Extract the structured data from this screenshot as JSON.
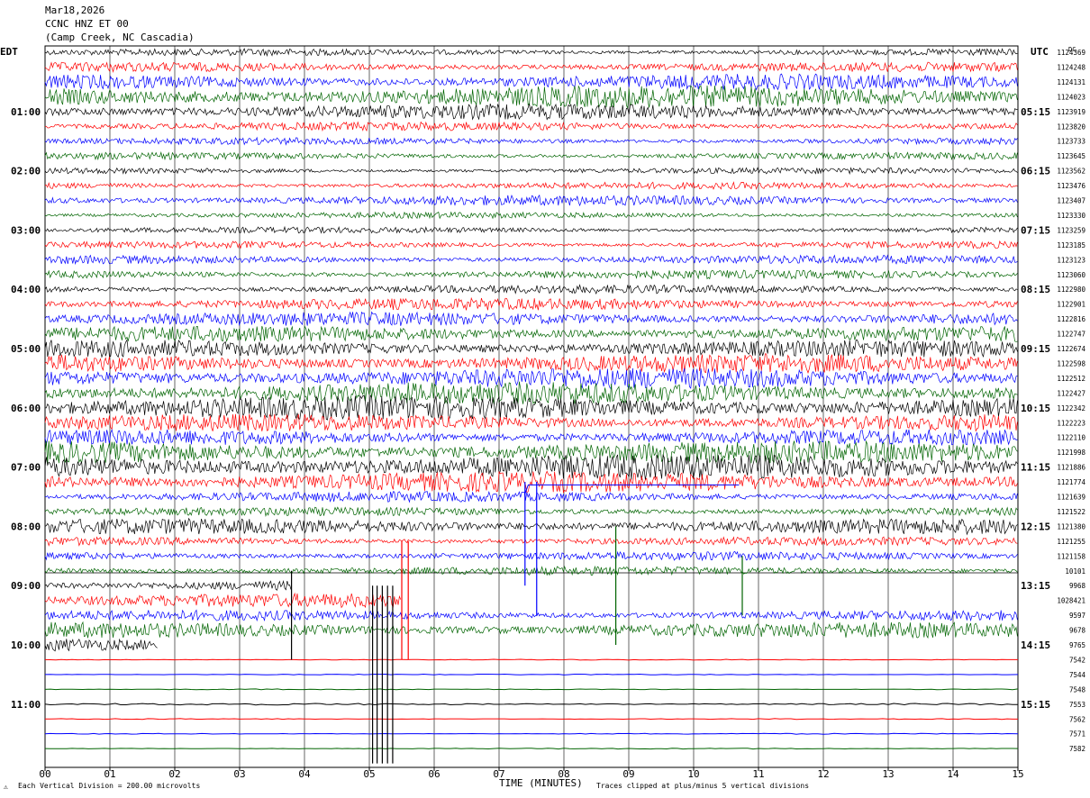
{
  "header": {
    "date": "Mar18,2026",
    "station": "CCNC HNZ ET 00",
    "location": "(Camp Creek, NC Cascadia)"
  },
  "left_axis_title": "EDT",
  "right_axis_title": "UTC",
  "right_corner_code": "DC",
  "footer": {
    "scale_note": "Each Vertical Division =  200.00 microvolts",
    "xlabel": "TIME (MINUTES)",
    "clip_note": "Traces clipped at plus/minus 5 vertical divisions",
    "corner_mark": "⚠"
  },
  "colors": {
    "black": "#000000",
    "red": "#ff0000",
    "blue": "#0000ff",
    "green": "#006400",
    "grid": "#000000"
  },
  "chart_data": {
    "type": "line",
    "description_type": "helicorder",
    "xlabel": "TIME (MINUTES)",
    "xlim": [
      0,
      15
    ],
    "x_ticks": [
      "00",
      "01",
      "02",
      "03",
      "04",
      "05",
      "06",
      "07",
      "08",
      "09",
      "10",
      "11",
      "12",
      "13",
      "14",
      "15"
    ],
    "trace_color_cycle": [
      "black",
      "red",
      "blue",
      "green"
    ],
    "trace_count": 48,
    "left_hour_labels": [
      {
        "trace": 4,
        "label": "01:00"
      },
      {
        "trace": 8,
        "label": "02:00"
      },
      {
        "trace": 12,
        "label": "03:00"
      },
      {
        "trace": 16,
        "label": "04:00"
      },
      {
        "trace": 20,
        "label": "05:00"
      },
      {
        "trace": 24,
        "label": "06:00"
      },
      {
        "trace": 28,
        "label": "07:00"
      },
      {
        "trace": 32,
        "label": "08:00"
      },
      {
        "trace": 36,
        "label": "09:00"
      },
      {
        "trace": 40,
        "label": "10:00"
      },
      {
        "trace": 44,
        "label": "11:00"
      }
    ],
    "right_hour_labels": [
      {
        "trace": 4,
        "label": "05:15"
      },
      {
        "trace": 8,
        "label": "06:15"
      },
      {
        "trace": 12,
        "label": "07:15"
      },
      {
        "trace": 16,
        "label": "08:15"
      },
      {
        "trace": 20,
        "label": "09:15"
      },
      {
        "trace": 24,
        "label": "10:15"
      },
      {
        "trace": 28,
        "label": "11:15"
      },
      {
        "trace": 32,
        "label": "12:15"
      },
      {
        "trace": 36,
        "label": "13:15"
      },
      {
        "trace": 40,
        "label": "14:15"
      },
      {
        "trace": 44,
        "label": "15:15"
      }
    ],
    "trace_counts": [
      "1124369",
      "1124248",
      "1124131",
      "1124023",
      "1123919",
      "1123820",
      "1123733",
      "1123645",
      "1123562",
      "1123476",
      "1123407",
      "1123330",
      "1123259",
      "1123185",
      "1123123",
      "1123060",
      "1122980",
      "1122901",
      "1122816",
      "1122747",
      "1122674",
      "1122598",
      "1122512",
      "1122427",
      "1122342",
      "1122223",
      "1122110",
      "1121998",
      "1121886",
      "1121774",
      "1121639",
      "1121522",
      "1121380",
      "1121255",
      "1121158",
      "10101",
      "9968",
      "1028421",
      "9597",
      "9678",
      "9765",
      "7542",
      "7544",
      "7548",
      "7553",
      "7562",
      "7571",
      "7582"
    ],
    "trace_noise_level": [
      0.4,
      0.55,
      0.9,
      1.3,
      0.9,
      0.5,
      0.4,
      0.4,
      0.35,
      0.4,
      0.6,
      0.35,
      0.35,
      0.4,
      0.5,
      0.5,
      0.5,
      0.7,
      0.8,
      0.9,
      1.0,
      1.1,
      1.2,
      1.3,
      1.4,
      1.0,
      0.9,
      1.3,
      1.5,
      1.2,
      0.6,
      0.5,
      0.9,
      0.5,
      0.5,
      0.5,
      0.7,
      0.8,
      0.6,
      0.9,
      0.8,
      0.05,
      0.05,
      0.05,
      0.1,
      0.05,
      0.05,
      0.05
    ],
    "trace_end_minute": [
      15,
      15,
      15,
      15,
      15,
      15,
      15,
      15,
      15,
      15,
      15,
      15,
      15,
      15,
      15,
      15,
      15,
      15,
      15,
      15,
      15,
      15,
      15,
      15,
      15,
      15,
      15,
      15,
      15,
      15,
      15,
      15,
      15,
      15,
      15,
      15,
      3.8,
      5.5,
      15,
      15,
      1.75,
      15,
      15,
      15,
      15,
      15,
      15,
      15
    ]
  }
}
